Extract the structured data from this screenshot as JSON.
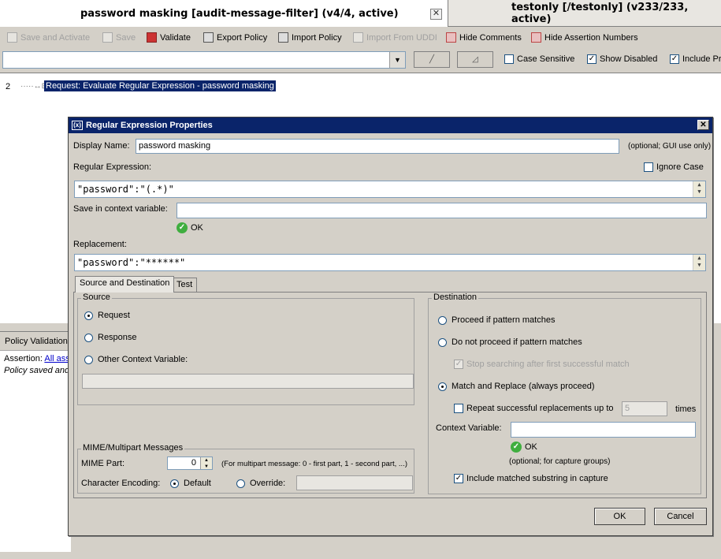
{
  "tabs": [
    {
      "label": "password masking [audit-message-filter] (v4/4, active)"
    },
    {
      "label": "testonly [/testonly] (v233/233, active)"
    }
  ],
  "toolbar": {
    "save_activate": "Save and Activate",
    "save": "Save",
    "validate": "Validate",
    "export_policy": "Export Policy",
    "import_policy": "Import Policy",
    "import_uddi": "Import From UDDI",
    "hide_comments": "Hide Comments",
    "hide_numbers": "Hide Assertion Numbers"
  },
  "search": {
    "value": "",
    "case_sensitive": "Case Sensitive",
    "show_disabled": "Show Disabled",
    "include_prefix": "Include Pr"
  },
  "policy": {
    "line_number": "2",
    "assertion": "Request: Evaluate Regular Expression - password masking"
  },
  "validation": {
    "header": "Policy Validation",
    "assertion_label": "Assertion:",
    "assertion_link": "All ass",
    "saved_text": "Policy saved and"
  },
  "dialog": {
    "title": "Regular Expression Properties",
    "display_name_label": "Display Name:",
    "display_name_value": "password masking",
    "display_name_hint": "(optional; GUI use only)",
    "regex_label": "Regular Expression:",
    "ignore_case": "Ignore Case",
    "regex_value": "\"password\":\"(.*)\"",
    "context_var_label": "Save in context variable:",
    "context_var_value": "",
    "ok_status": "OK",
    "replacement_label": "Replacement:",
    "replacement_value": "\"password\":\"******\"",
    "tab_source": "Source and Destination",
    "tab_test": "Test",
    "source": {
      "title": "Source",
      "request": "Request",
      "response": "Response",
      "other": "Other Context Variable:",
      "other_value": ""
    },
    "mime": {
      "title": "MIME/Multipart Messages",
      "part_label": "MIME Part:",
      "part_value": "0",
      "part_hint": "(For multipart message: 0 - first part, 1 - second part, ...)",
      "encoding_label": "Character Encoding:",
      "default": "Default",
      "override": "Override:",
      "override_value": ""
    },
    "destination": {
      "title": "Destination",
      "proceed": "Proceed if pattern matches",
      "not_proceed": "Do not proceed if pattern matches",
      "stop_searching": "Stop searching after first successful match",
      "match_replace": "Match and Replace (always proceed)",
      "repeat": "Repeat successful replacements up to",
      "repeat_value": "5",
      "times": "times",
      "context_var_label": "Context Variable:",
      "context_var_value": "",
      "ok_status": "OK",
      "hint": "(optional; for capture groups)",
      "include_substring": "Include matched substring in capture"
    },
    "ok_button": "OK",
    "cancel_button": "Cancel"
  }
}
